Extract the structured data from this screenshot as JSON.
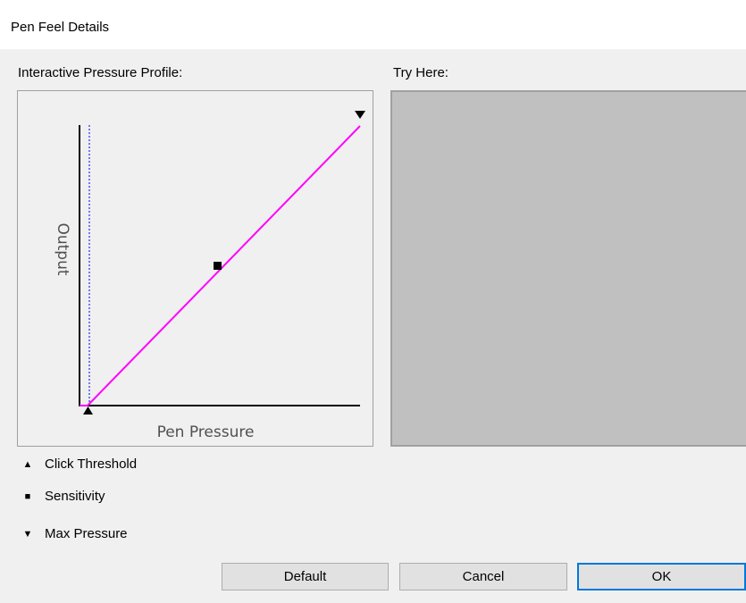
{
  "window": {
    "title": "Pen Feel Details"
  },
  "profile": {
    "label": "Interactive Pressure Profile:",
    "y_axis_label": "Output",
    "x_axis_label": "Pen Pressure",
    "curve_color": "#ff00ff",
    "threshold_line_color": "#0000ff"
  },
  "try_here": {
    "label": "Try Here:",
    "color": "#c0c0c0"
  },
  "legend": [
    {
      "symbol": "▲",
      "icon": "click-threshold-icon",
      "label": "Click Threshold"
    },
    {
      "symbol": "■",
      "icon": "sensitivity-icon",
      "label": "Sensitivity"
    },
    {
      "symbol": "▼",
      "icon": "max-pressure-icon",
      "label": "Max Pressure"
    }
  ],
  "buttons": {
    "default": "Default",
    "cancel": "Cancel",
    "ok": "OK"
  }
}
